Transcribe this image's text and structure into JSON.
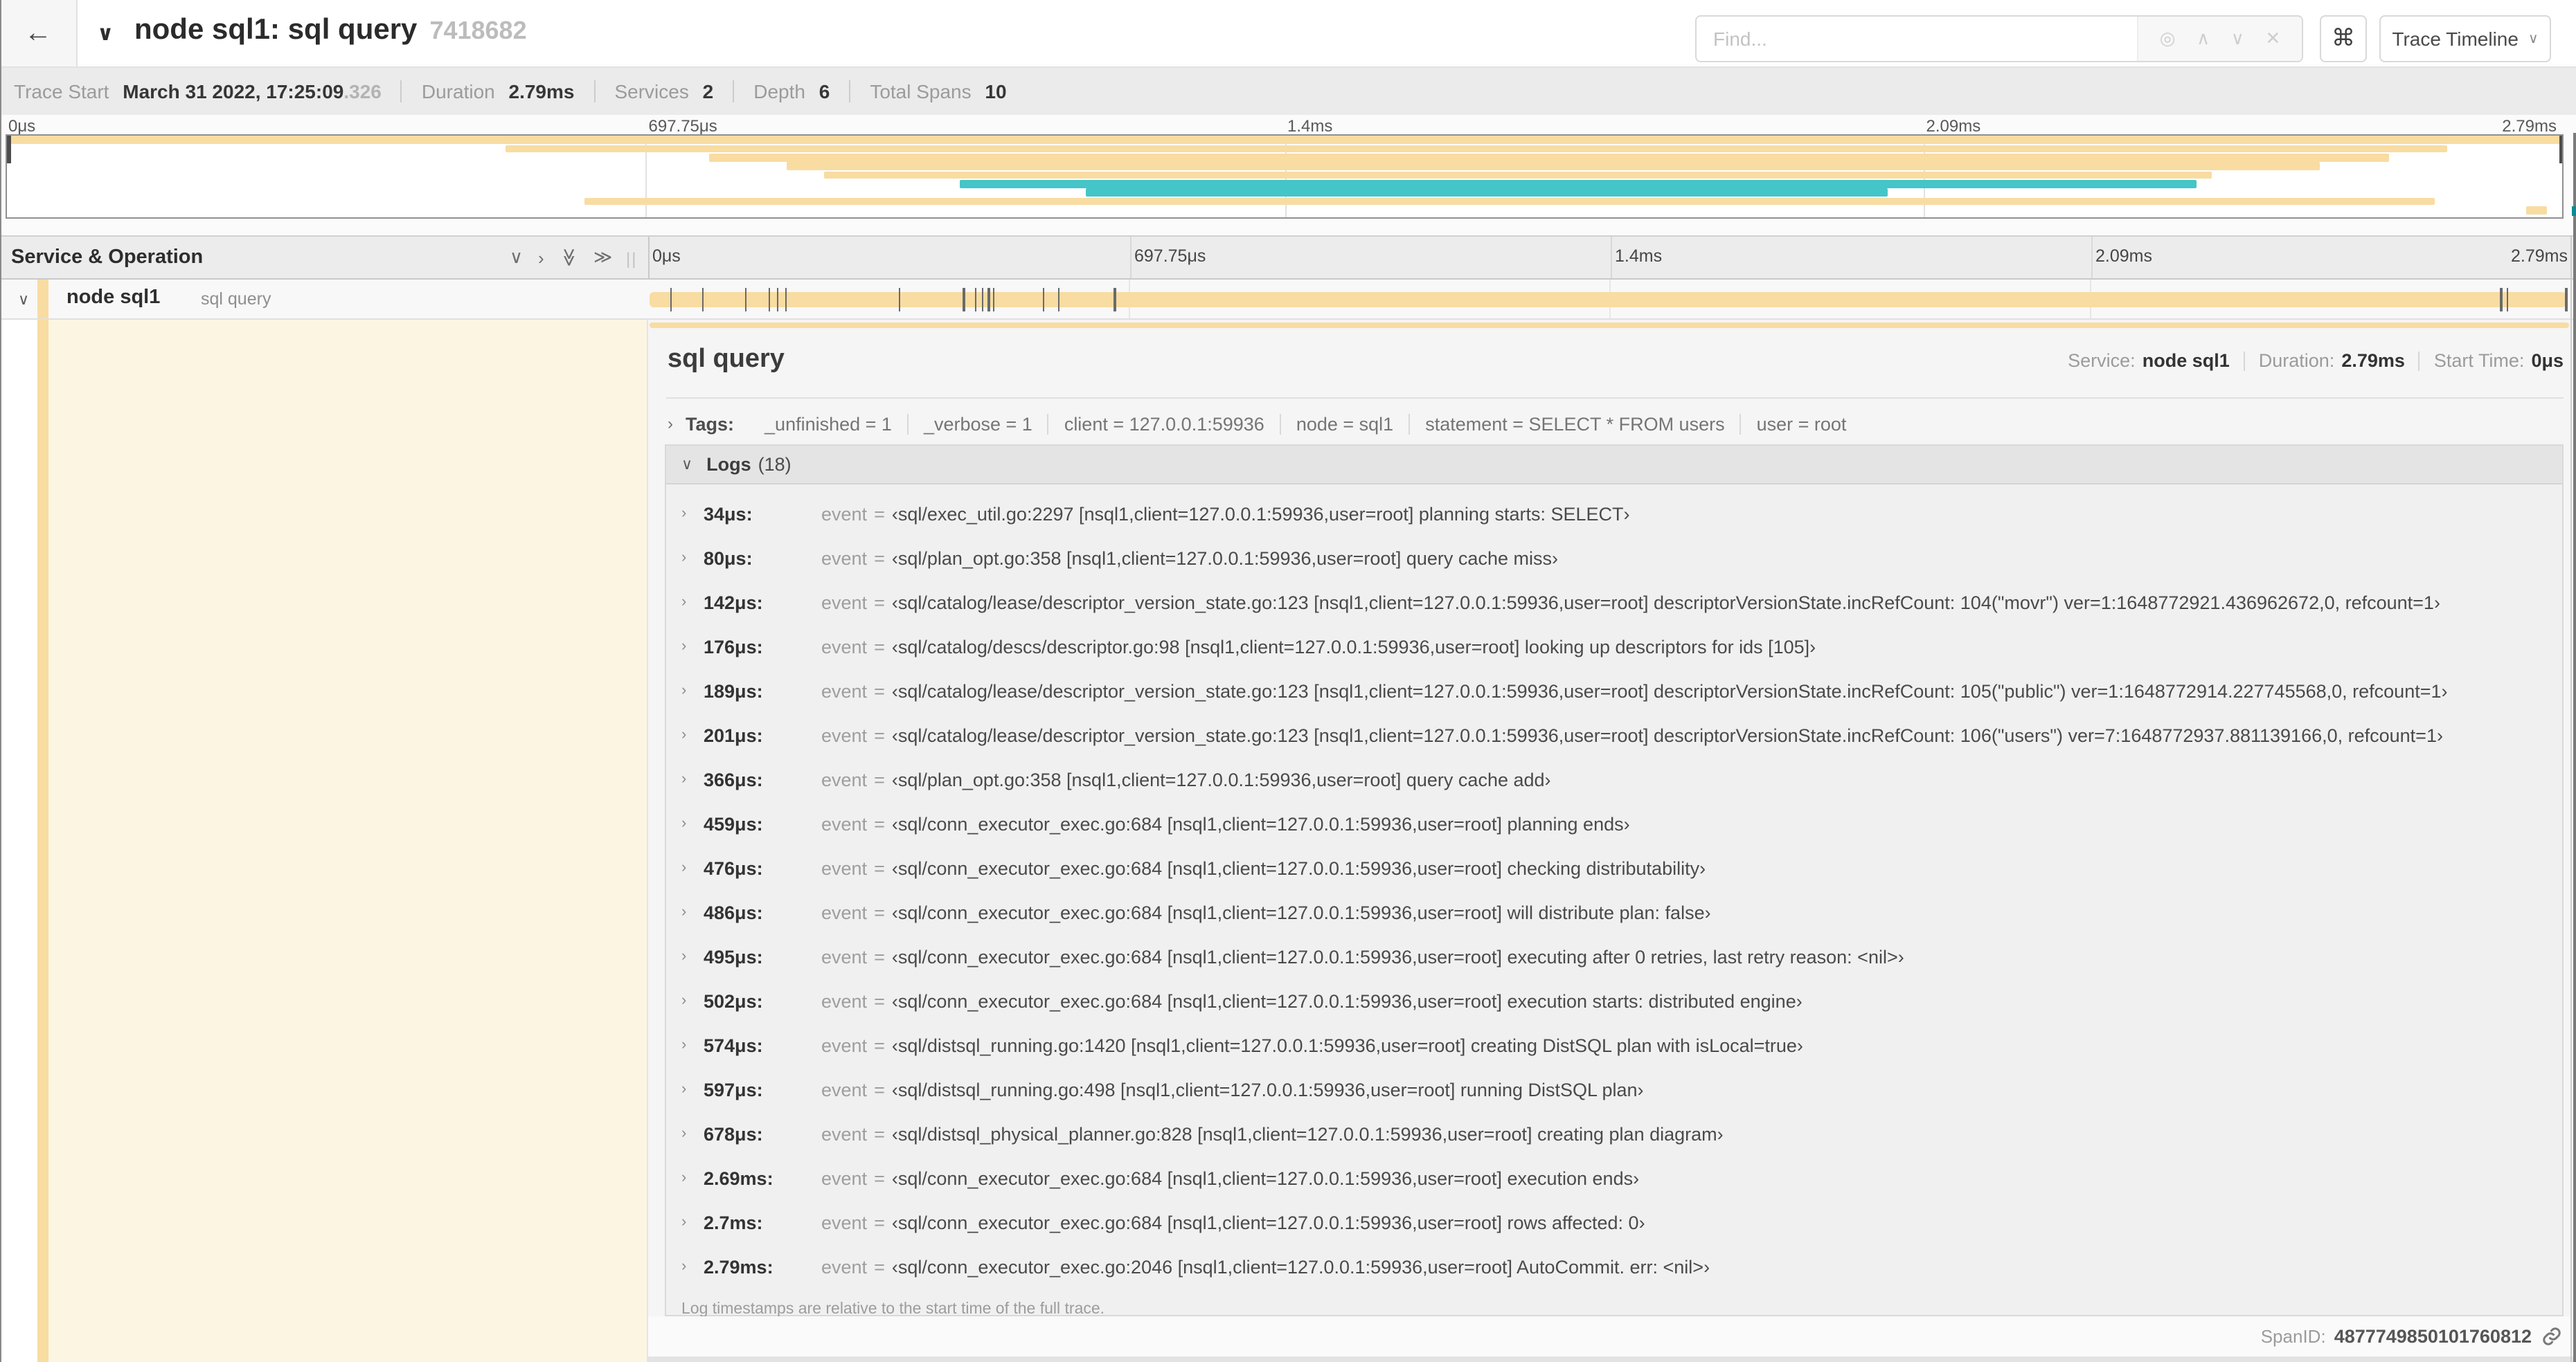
{
  "colors": {
    "span_tan": "#f8dca1",
    "span_teal": "#44c5c8",
    "edge_teal": "#0f8a92"
  },
  "icons": {
    "back": "←",
    "chevron_down": "∨",
    "chevron_right": "›",
    "double_right": "≫",
    "caret": "∨",
    "command": "⌘",
    "target": "◎",
    "up": "∧",
    "down": "∨",
    "clear": "✕",
    "grip": "||",
    "expand_chevron": "›",
    "collapse_chevron": "∨"
  },
  "header": {
    "title": "node sql1: sql query",
    "trace_id": "7418682",
    "find_placeholder": "Find...",
    "view_button": "Trace Timeline"
  },
  "summary": {
    "items": [
      {
        "label": "Trace Start",
        "value": "March 31 2022, 17:25:09",
        "suffix": ".326"
      },
      {
        "label": "Duration",
        "value": "2.79ms"
      },
      {
        "label": "Services",
        "value": "2"
      },
      {
        "label": "Depth",
        "value": "6"
      },
      {
        "label": "Total Spans",
        "value": "10"
      }
    ]
  },
  "minimap": {
    "ticks": [
      "0μs",
      "697.75μs",
      "1.4ms",
      "2.09ms",
      "2.79ms"
    ],
    "gridline_percents": [
      25,
      50,
      75
    ],
    "rows": [
      {
        "color": "tan",
        "start": 0,
        "end": 100
      },
      {
        "color": "tan",
        "start": 19.5,
        "end": 95.5
      },
      {
        "color": "tan",
        "start": 27.5,
        "end": 93.2
      },
      {
        "color": "tan",
        "start": 30.5,
        "end": 90.5
      },
      {
        "color": "tan",
        "start": 32,
        "end": 86.3
      },
      {
        "color": "teal",
        "start": 37.3,
        "end": 85.7
      },
      {
        "color": "teal",
        "start": 42.2,
        "end": 73.6
      },
      {
        "color": "tan",
        "start": 22.6,
        "end": 95
      },
      {
        "color": "tan",
        "start": 98.6,
        "end": 99.4
      }
    ]
  },
  "timeline": {
    "column_header": "Service & Operation",
    "ticks": [
      "0μs",
      "697.75μs",
      "1.4ms",
      "2.09ms",
      "2.79ms"
    ],
    "gridline_percents": [
      25,
      50,
      75
    ],
    "span_row": {
      "service": "node sql1",
      "operation": "sql query"
    },
    "log_tick_percents": [
      1.22,
      2.87,
      5.09,
      6.31,
      6.77,
      7.2,
      13.12,
      16.45,
      17.06,
      17.42,
      17.74,
      18.0,
      20.57,
      21.4,
      24.3,
      96.42,
      96.77,
      99.8
    ]
  },
  "detail": {
    "title": "sql query",
    "meta": [
      {
        "label": "Service:",
        "value": "node sql1"
      },
      {
        "label": "Duration:",
        "value": "2.79ms"
      },
      {
        "label": "Start Time:",
        "value": "0μs"
      }
    ],
    "tags_label": "Tags:",
    "tags": [
      "_unfinished = 1",
      "_verbose = 1",
      "client = 127.0.0.1:59936",
      "node = sql1",
      "statement = SELECT * FROM users",
      "user = root"
    ],
    "logs_label": "Logs",
    "logs_count": "(18)",
    "logs": [
      {
        "time": "34μs:",
        "key": "event",
        "value": "‹sql/exec_util.go:2297 [nsql1,client=127.0.0.1:59936,user=root] planning starts: SELECT›"
      },
      {
        "time": "80μs:",
        "key": "event",
        "value": "‹sql/plan_opt.go:358 [nsql1,client=127.0.0.1:59936,user=root] query cache miss›"
      },
      {
        "time": "142μs:",
        "key": "event",
        "value": "‹sql/catalog/lease/descriptor_version_state.go:123 [nsql1,client=127.0.0.1:59936,user=root] descriptorVersionState.incRefCount: 104(\"movr\") ver=1:1648772921.436962672,0, refcount=1›"
      },
      {
        "time": "176μs:",
        "key": "event",
        "value": "‹sql/catalog/descs/descriptor.go:98 [nsql1,client=127.0.0.1:59936,user=root] looking up descriptors for ids [105]›"
      },
      {
        "time": "189μs:",
        "key": "event",
        "value": "‹sql/catalog/lease/descriptor_version_state.go:123 [nsql1,client=127.0.0.1:59936,user=root] descriptorVersionState.incRefCount: 105(\"public\") ver=1:1648772914.227745568,0, refcount=1›"
      },
      {
        "time": "201μs:",
        "key": "event",
        "value": "‹sql/catalog/lease/descriptor_version_state.go:123 [nsql1,client=127.0.0.1:59936,user=root] descriptorVersionState.incRefCount: 106(\"users\") ver=7:1648772937.881139166,0, refcount=1›"
      },
      {
        "time": "366μs:",
        "key": "event",
        "value": "‹sql/plan_opt.go:358 [nsql1,client=127.0.0.1:59936,user=root] query cache add›"
      },
      {
        "time": "459μs:",
        "key": "event",
        "value": "‹sql/conn_executor_exec.go:684 [nsql1,client=127.0.0.1:59936,user=root] planning ends›"
      },
      {
        "time": "476μs:",
        "key": "event",
        "value": "‹sql/conn_executor_exec.go:684 [nsql1,client=127.0.0.1:59936,user=root] checking distributability›"
      },
      {
        "time": "486μs:",
        "key": "event",
        "value": "‹sql/conn_executor_exec.go:684 [nsql1,client=127.0.0.1:59936,user=root] will distribute plan: false›"
      },
      {
        "time": "495μs:",
        "key": "event",
        "value": "‹sql/conn_executor_exec.go:684 [nsql1,client=127.0.0.1:59936,user=root] executing after 0 retries, last retry reason: <nil>›"
      },
      {
        "time": "502μs:",
        "key": "event",
        "value": "‹sql/conn_executor_exec.go:684 [nsql1,client=127.0.0.1:59936,user=root] execution starts: distributed engine›"
      },
      {
        "time": "574μs:",
        "key": "event",
        "value": "‹sql/distsql_running.go:1420 [nsql1,client=127.0.0.1:59936,user=root] creating DistSQL plan with isLocal=true›"
      },
      {
        "time": "597μs:",
        "key": "event",
        "value": "‹sql/distsql_running.go:498 [nsql1,client=127.0.0.1:59936,user=root] running DistSQL plan›"
      },
      {
        "time": "678μs:",
        "key": "event",
        "value": "‹sql/distsql_physical_planner.go:828 [nsql1,client=127.0.0.1:59936,user=root] creating plan diagram›"
      },
      {
        "time": "2.69ms:",
        "key": "event",
        "value": "‹sql/conn_executor_exec.go:684 [nsql1,client=127.0.0.1:59936,user=root] execution ends›"
      },
      {
        "time": "2.7ms:",
        "key": "event",
        "value": "‹sql/conn_executor_exec.go:684 [nsql1,client=127.0.0.1:59936,user=root] rows affected: 0›"
      },
      {
        "time": "2.79ms:",
        "key": "event",
        "value": "‹sql/conn_executor_exec.go:2046 [nsql1,client=127.0.0.1:59936,user=root] AutoCommit. err: <nil>›"
      }
    ],
    "logs_footer": "Log timestamps are relative to the start time of the full trace.",
    "span_id_label": "SpanID:",
    "span_id": "4877749850101760812"
  }
}
